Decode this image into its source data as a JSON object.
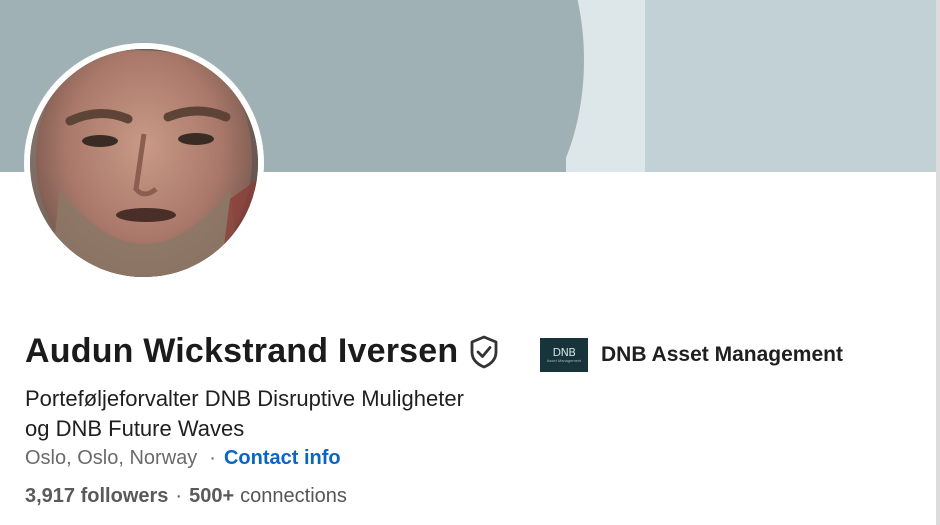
{
  "profile": {
    "name": "Audun Wickstrand Iversen",
    "headline_line1": "Porteføljeforvalter DNB Disruptive Muligheter",
    "headline_line2": "og DNB Future Waves",
    "location": "Oslo, Oslo, Norway",
    "location_separator": "·",
    "contact_label": "Contact info",
    "followers_count": "3,917 followers",
    "stats_separator": "·",
    "connections_count": "500+",
    "connections_label": "connections"
  },
  "company": {
    "name": "DNB Asset Management",
    "logo_text": "DNB",
    "logo_subtext": "Asset Management"
  },
  "icons": {
    "verified": "verified-shield-icon"
  },
  "colors": {
    "link": "#0a66c2",
    "banner": "#a0b1b5",
    "banner_light": "#dde6e8",
    "banner_right": "#c2d1d5",
    "company_logo_bg": "#16343a"
  }
}
